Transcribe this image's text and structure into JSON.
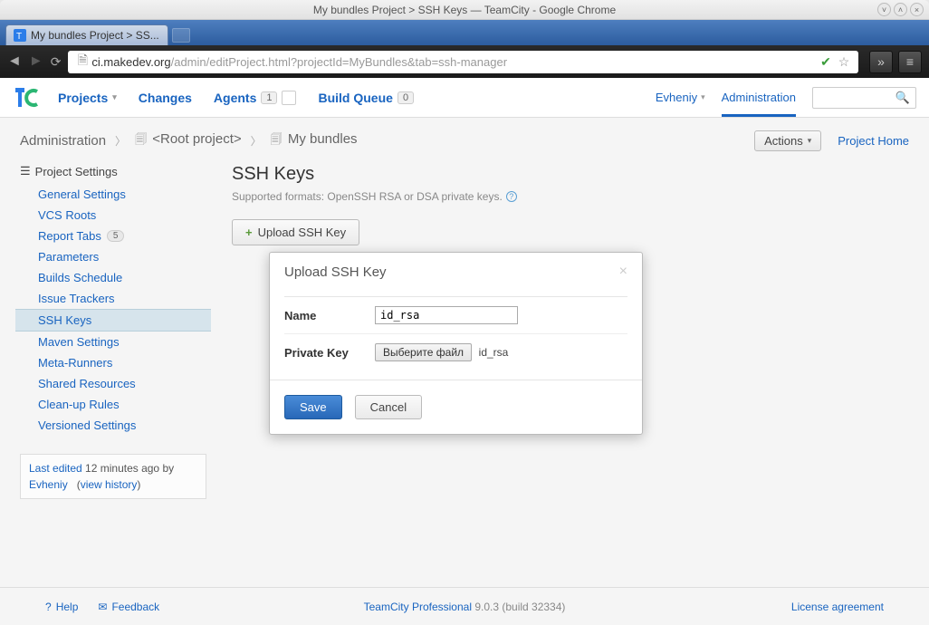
{
  "window": {
    "title": "My bundles Project > SSH Keys — TeamCity - Google Chrome",
    "tab_title": "My bundles Project > SS...",
    "url_host": "ci.makedev.org",
    "url_path": "/admin/editProject.html?projectId=MyBundles&tab=ssh-manager"
  },
  "nav": {
    "projects": "Projects",
    "changes": "Changes",
    "agents": "Agents",
    "agents_count": "1",
    "build_queue": "Build Queue",
    "build_queue_count": "0",
    "user": "Evheniy",
    "administration": "Administration"
  },
  "breadcrumb": {
    "administration": "Administration",
    "root": "<Root project>",
    "project": "My bundles",
    "actions": "Actions",
    "project_home": "Project Home"
  },
  "sidebar": {
    "title": "Project Settings",
    "items": [
      {
        "label": "General Settings"
      },
      {
        "label": "VCS Roots"
      },
      {
        "label": "Report Tabs",
        "badge": "5"
      },
      {
        "label": "Parameters"
      },
      {
        "label": "Builds Schedule"
      },
      {
        "label": "Issue Trackers"
      },
      {
        "label": "SSH Keys"
      },
      {
        "label": "Maven Settings"
      },
      {
        "label": "Meta-Runners"
      },
      {
        "label": "Shared Resources"
      },
      {
        "label": "Clean-up Rules"
      },
      {
        "label": "Versioned Settings"
      }
    ],
    "last_edited_prefix": "Last edited",
    "last_edited_time": " 12 minutes ago by ",
    "last_edited_user": "Evheniy",
    "view_history": "view history"
  },
  "main": {
    "title": "SSH Keys",
    "subtitle": "Supported formats: OpenSSH RSA or DSA private keys.",
    "upload_button": "Upload SSH Key"
  },
  "dialog": {
    "title": "Upload SSH Key",
    "name_label": "Name",
    "name_value": "id_rsa",
    "key_label": "Private Key",
    "file_button": "Выберите файл",
    "file_name": "id_rsa",
    "save": "Save",
    "cancel": "Cancel"
  },
  "footer": {
    "help": "Help",
    "feedback": "Feedback",
    "product": "TeamCity Professional",
    "version": " 9.0.3 (build 32334)",
    "license": "License agreement"
  }
}
